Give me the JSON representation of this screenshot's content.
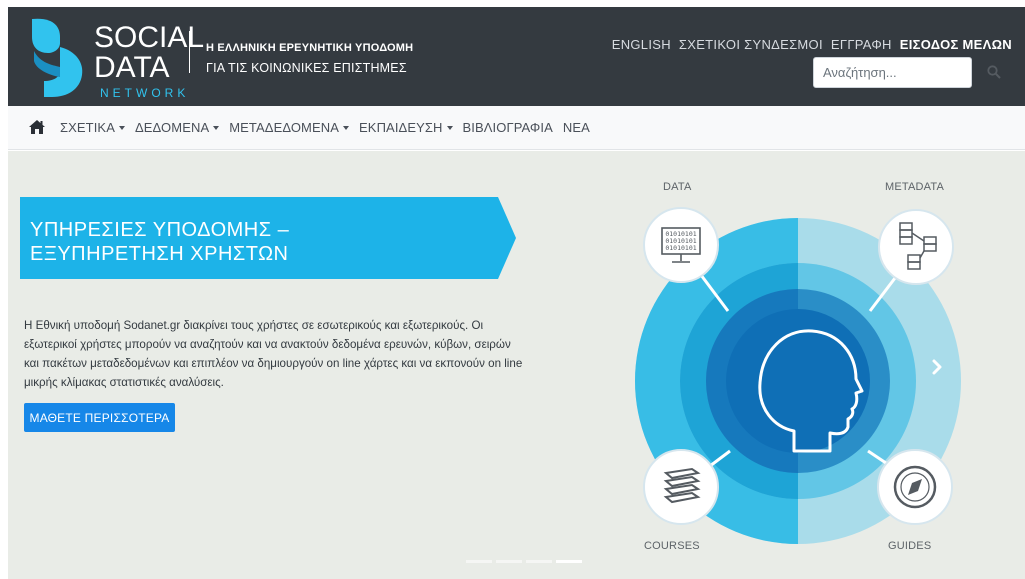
{
  "brand": {
    "logo_line1": "SOCIAL",
    "logo_line2": "DATA",
    "logo_line3": "NETWORK",
    "tagline_line1": "Η ΕΛΛΗΝΙΚΗ ΕΡΕΥΝΗΤΙΚΗ ΥΠΟΔΟΜΗ",
    "tagline_line2": "ΓΙΑ ΤΙΣ ΚΟΙΝΩΝΙΚΕΣ ΕΠΙΣΤΗΜΕΣ"
  },
  "topnav": {
    "english": "ENGLISH",
    "links": "ΣΧΕΤΙΚΟΙ ΣΥΝΔΕΣΜΟΙ",
    "register": "ΕΓΓΡΑΦΗ",
    "login": "ΕΙΣΟΔΟΣ ΜΕΛΩΝ"
  },
  "search": {
    "placeholder": "Αναζήτηση...",
    "icon": "search-icon"
  },
  "mainnav": {
    "home_icon": "home-icon",
    "items": [
      {
        "label": "ΣΧΕΤΙΚΑ",
        "dropdown": true
      },
      {
        "label": "ΔΕΔΟΜΕΝΑ",
        "dropdown": true
      },
      {
        "label": "ΜΕΤΑΔΕΔΟΜΕΝΑ",
        "dropdown": true
      },
      {
        "label": "ΕΚΠΑΙΔΕΥΣΗ",
        "dropdown": true
      },
      {
        "label": "ΒΙΒΛΙΟΓΡΑΦΙΑ",
        "dropdown": false
      },
      {
        "label": "ΝΕΑ",
        "dropdown": false
      }
    ]
  },
  "hero": {
    "banner_line1": "ΥΠΗΡΕΣΙΕΣ ΥΠΟΔΟΜΗΣ –",
    "banner_line2": "ΕΞΥΠΗΡΕΤΗΣΗ ΧΡΗΣΤΩΝ",
    "description": "Η Εθνική υποδομή Sodanet.gr διακρίνει τους χρήστες σε εσωτερικούς και εξωτερικούς. Οι εξωτερικοί χρήστες μπορούν να αναζητούν και να ανακτούν δεδομένα ερευνών, κύβων, σειρών και πακέτων μεταδεδομένων και επιπλέον να δημιουργούν on line χάρτες και να εκπονούν on line μικρής κλίμακας στατιστικές αναλύσεις.",
    "cta_label": "ΜΑΘΕΤΕ ΠΕΡΙΣΣΟΤΕΡΑ"
  },
  "diagram": {
    "data_label": "DATA",
    "metadata_label": "METADATA",
    "courses_label": "COURSES",
    "guides_label": "GUIDES"
  },
  "carousel": {
    "slides_total": 4,
    "active_slide": 4
  },
  "colors": {
    "header_bg": "#343a40",
    "accent_blue": "#1db3e8",
    "cta_blue": "#1687e8",
    "hero_bg": "#e9ece7"
  }
}
